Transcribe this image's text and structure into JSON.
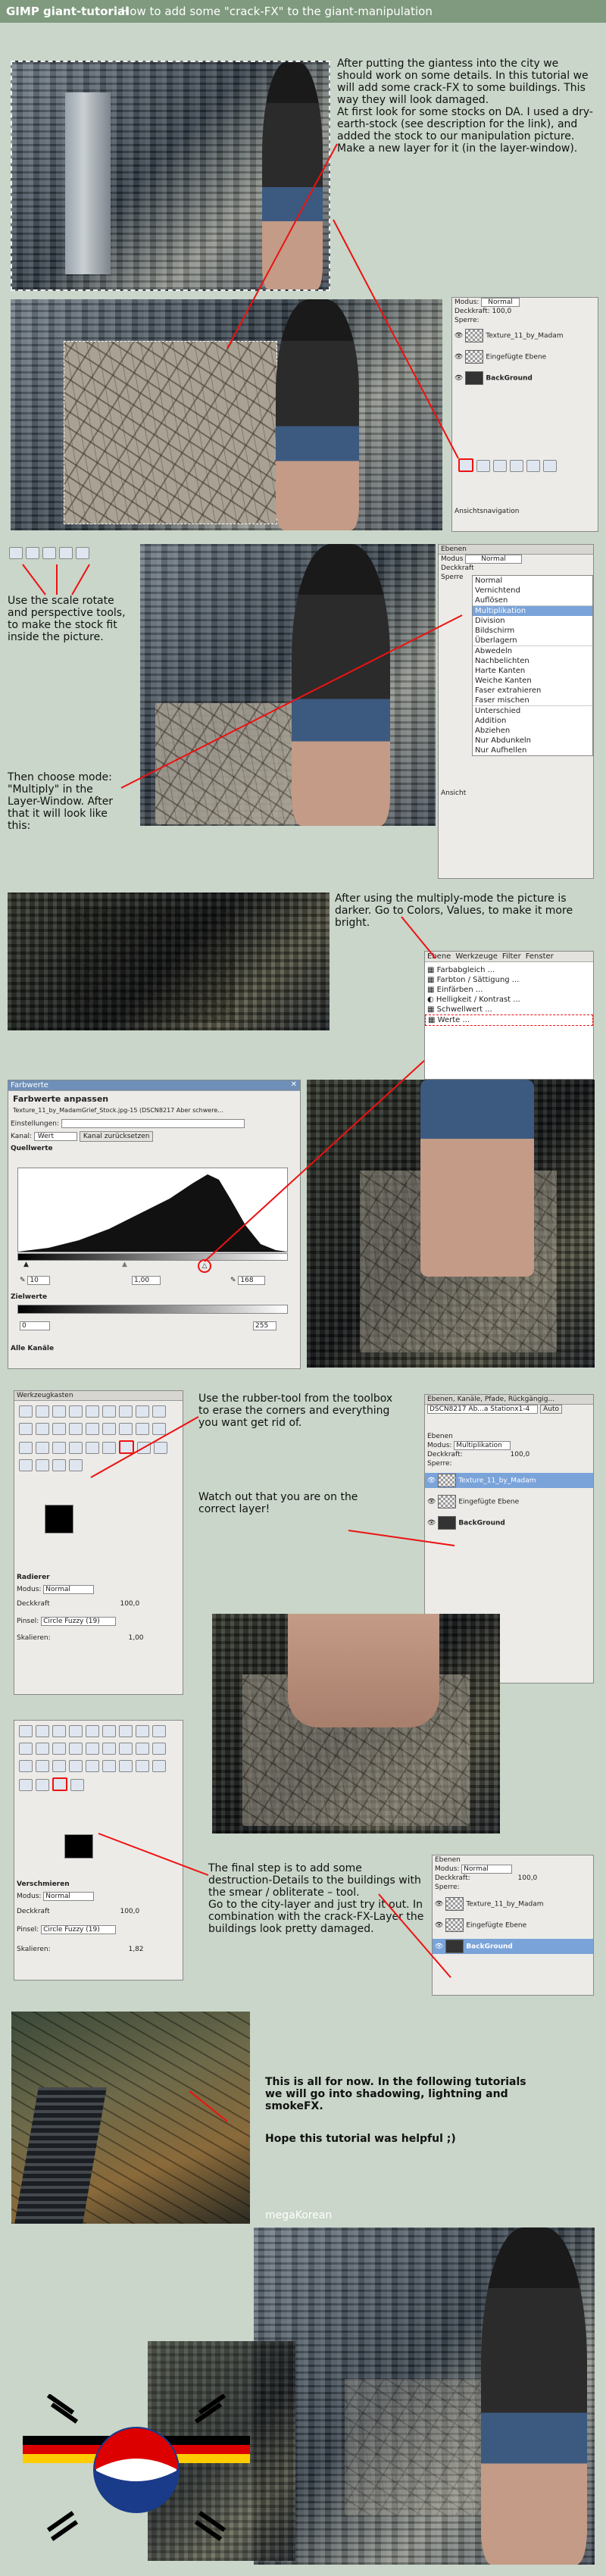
{
  "header": {
    "title": "GIMP giant-tutorial",
    "subtitle": "How to add some \"crack-FX\" to the giant-manipulation"
  },
  "section1": {
    "text": "After putting the giantess into the city we should work on some details. In this tutorial we will add some crack-FX to some buildings. This way they will look damaged.\nAt first look for some stocks on DA. I used a dry-earth-stock (see description for the link), and added the stock to our manipulation picture. Make a new layer for it (in the layer-window)."
  },
  "layers1": {
    "modus_label": "Modus:",
    "modus_value": "Normal",
    "deckkraft_label": "Deckkraft:",
    "deckkraft_value": "100,0",
    "sperre_label": "Sperre:",
    "items": [
      "Texture_11_by_Madam",
      "Eingefügte Ebene",
      "BackGround"
    ],
    "footer": "Ansichtsnavigation"
  },
  "section2": {
    "text1": "Use the scale rotate and perspective tools, to make the stock fit inside the picture.",
    "text2": "Then choose mode: \"Multiply\" in the Layer-Window. After that it will look like this:"
  },
  "modemenu": {
    "title": "Ebenen",
    "modus_label": "Modus",
    "modus_value": "Normal",
    "deckkraft_label": "Deckkraft",
    "sperre_label": "Sperre",
    "ansicht_label": "Ansicht",
    "items": [
      "Normal",
      "Vernichtend",
      "Auflösen",
      "Multiplikation",
      "Division",
      "Bildschirm",
      "Überlagern",
      "Abwedeln",
      "Nachbelichten",
      "Harte Kanten",
      "Weiche Kanten",
      "Faser extrahieren",
      "Faser mischen",
      "Unterschied",
      "Addition",
      "Abziehen",
      "Nur Abdunkeln",
      "Nur Aufhellen"
    ],
    "selected": "Multiplikation"
  },
  "section3": {
    "text": "After using the multiply-mode the picture is darker. Go to Colors, Values, to make it more bright."
  },
  "colormenu": {
    "bar": [
      "Ebene",
      "Werkzeuge",
      "Filter",
      "Fenster"
    ],
    "items": [
      "Farbabgleich ...",
      "Farbton / Sättigung ...",
      "Einfärben ...",
      "Helligkeit / Kontrast ...",
      "Schwellwert ...",
      "Werte ..."
    ]
  },
  "farbwerte": {
    "window_title": "Farbwerte",
    "heading": "Farbwerte anpassen",
    "subheading": "Texture_11_by_MadamGrief_Stock.jpg-15 (DSCN8217 Aber schwere...",
    "einstellungen_label": "Einstellungen:",
    "kanal_label": "Kanal:",
    "kanal_value": "Wert",
    "reset_label": "Kanal zurücksetzen",
    "quellwerte_label": "Quellwerte",
    "in_low": "10",
    "gamma": "1,00",
    "in_high": "168",
    "zielwerte_label": "Zielwerte",
    "out_low": "0",
    "out_high": "255",
    "alle_kanaele": "Alle Kanäle"
  },
  "section4": {
    "text1": "Use the rubber-tool from the toolbox to erase the corners and everything you want get rid of.",
    "text2": "Watch out that you are on the correct layer!"
  },
  "toolbox1": {
    "title": "Werkzeugkasten",
    "radierer_label": "Radierer",
    "modus_label": "Modus:",
    "modus_value": "Normal",
    "deckkraft_label": "Deckkraft",
    "deckkraft_value": "100,0",
    "pinsel_label": "Pinsel:",
    "pinsel_value": "Circle Fuzzy (19)",
    "skalieren_label": "Skalieren:",
    "skalieren_value": "1,00"
  },
  "layers2": {
    "title": "Ebenen, Kanäle, Pfade, Rückgängig...",
    "image_label": "DSCN8217 Ab...a Stationx1-4",
    "auto_label": "Auto",
    "ebenen_label": "Ebenen",
    "modus_label": "Modus:",
    "modus_value": "Multiplikation",
    "deckkraft_label": "Deckkraft:",
    "deckkraft_value": "100,0",
    "sperre_label": "Sperre:",
    "items": [
      "Texture_11_by_Madam",
      "Eingefügte Ebene",
      "BackGround"
    ]
  },
  "section5": {
    "text": "The final step is to add some destruction-Details to the buildings with the smear / obliterate – tool.\nGo to the city-layer and just try it out. In combination with the crack-FX-Layer the buildings look pretty damaged."
  },
  "toolbox2": {
    "verschmieren_label": "Verschmieren",
    "modus_label": "Modus:",
    "modus_value": "Normal",
    "deckkraft_label": "Deckkraft",
    "deckkraft_value": "100,0",
    "pinsel_label": "Pinsel:",
    "pinsel_value": "Circle Fuzzy (19)",
    "skalieren_label": "Skalieren:",
    "skalieren_value": "1,82"
  },
  "layers3": {
    "ebenen_label": "Ebenen",
    "modus_label": "Modus:",
    "modus_value": "Normal",
    "deckkraft_label": "Deckkraft:",
    "deckkraft_value": "100,0",
    "sperre_label": "Sperre:",
    "items": [
      "Texture_11_by_Madam",
      "Eingefügte Ebene",
      "BackGround"
    ]
  },
  "section6": {
    "text1": "This is all for now. In the following tutorials we will go into shadowing, lightning and smokeFX.",
    "text2": "Hope this tutorial was helpful ;)",
    "signature": "megaKorean"
  }
}
